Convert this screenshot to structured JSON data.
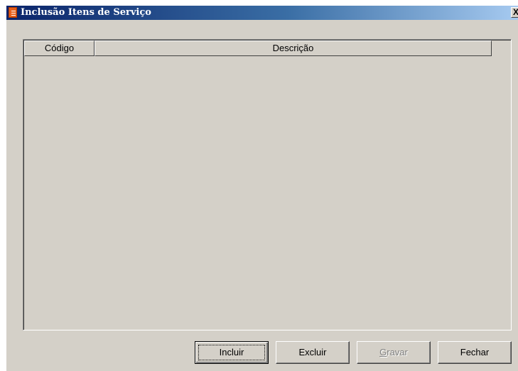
{
  "window": {
    "title": "Inclusão Itens de Serviço",
    "close_glyph": "X",
    "title_icon": "document-icon"
  },
  "grid": {
    "columns": [
      "Código",
      "Descrição"
    ],
    "rows": []
  },
  "buttons": {
    "incluir": "Incluir",
    "excluir": "Excluir",
    "gravar_mnemonic": "G",
    "gravar_rest": "ravar",
    "fechar": "Fechar"
  },
  "colors": {
    "face": "#d4d0c8",
    "title_start": "#0a246a",
    "title_end": "#a6caf0",
    "disabled_text": "#808080"
  }
}
